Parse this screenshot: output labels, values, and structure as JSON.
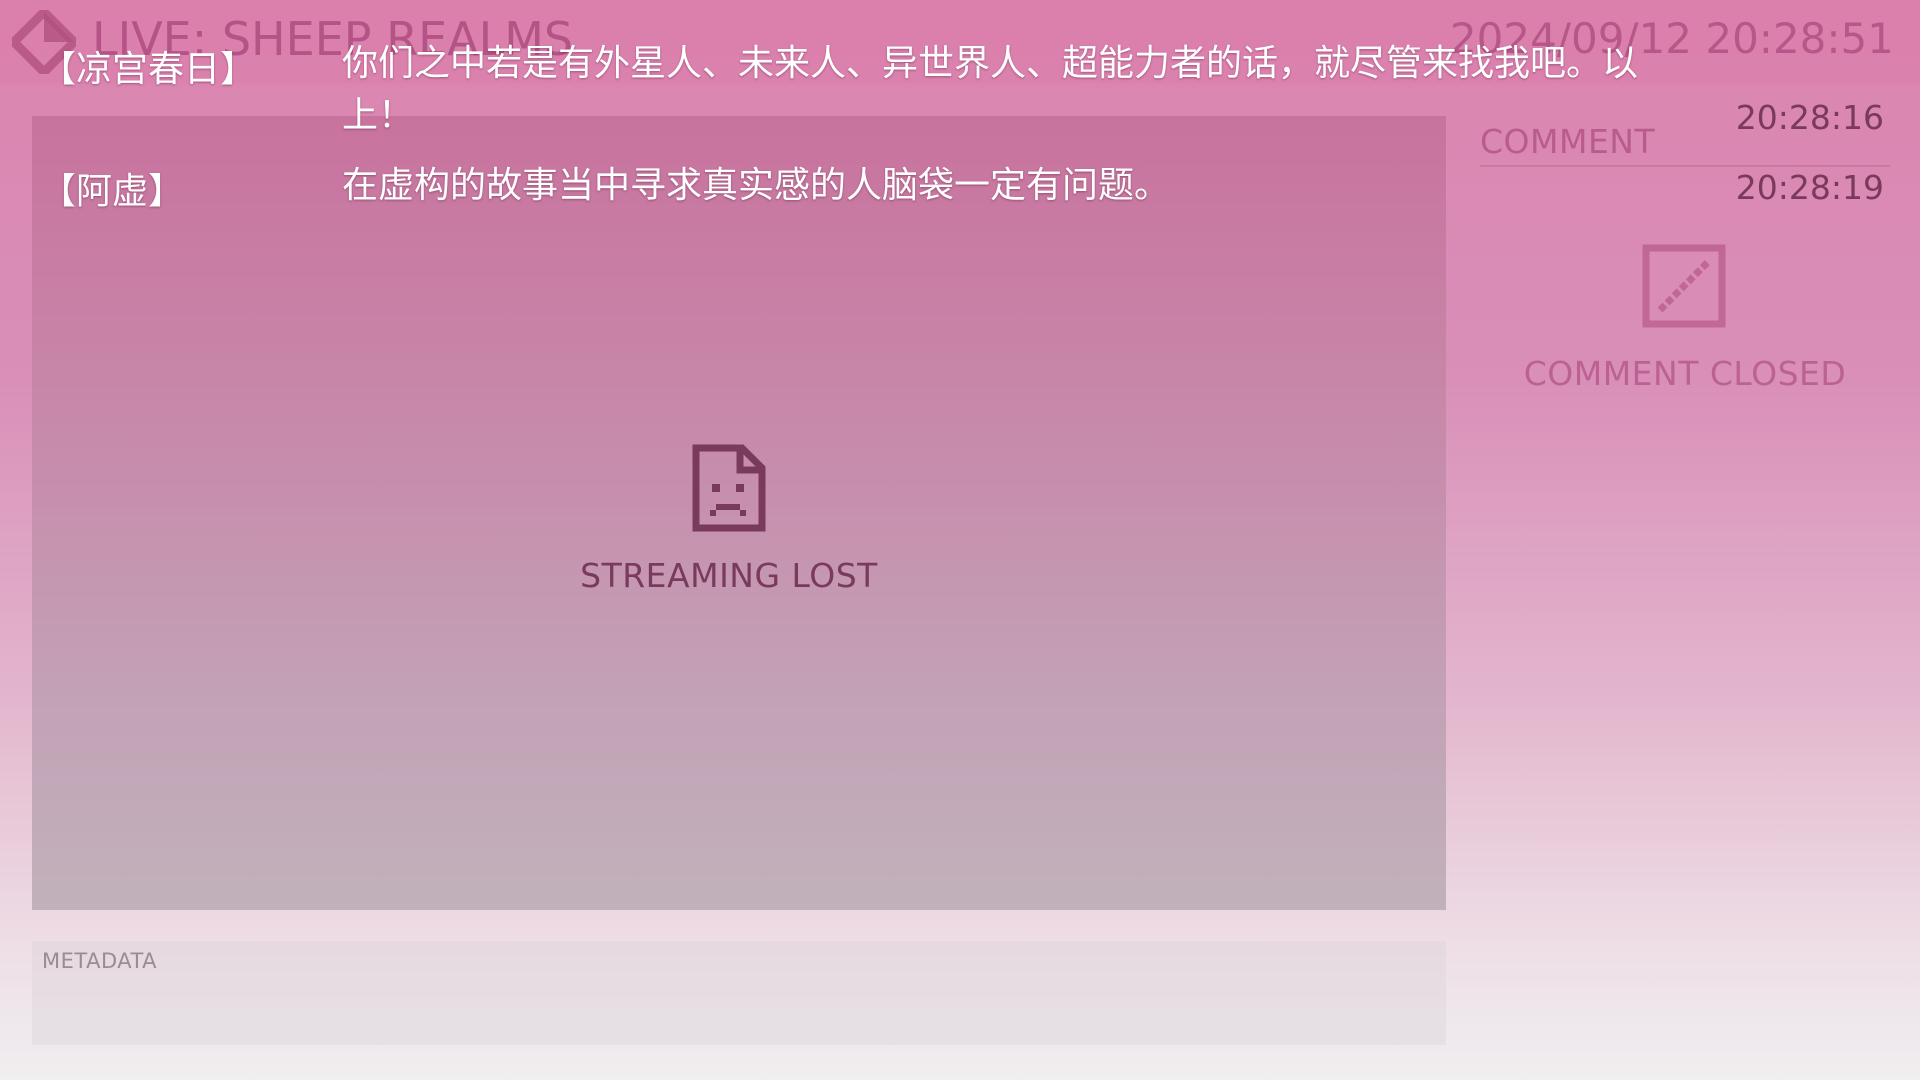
{
  "header": {
    "title": "LIVE: SHEEP REALMS",
    "datetime": "2024/09/12 20:28:51",
    "logo_icon": "diamond-logo-icon"
  },
  "stream": {
    "status_text": "STREAMING LOST",
    "status_icon": "sad-file-icon"
  },
  "metadata": {
    "label": "METADATA"
  },
  "comments": {
    "header": "COMMENT",
    "status_text": "COMMENT CLOSED",
    "status_icon": "comment-closed-icon"
  },
  "dialogue": [
    {
      "speaker": "【凉宫春日】",
      "text": "你们之中若是有外星人、未来人、异世界人、超能力者的话，就尽管来找我吧。以上！",
      "time": "20:28:16"
    },
    {
      "speaker": "【阿虚】",
      "text": "在虚构的故事当中寻求真实感的人脑袋一定有问题。",
      "time": "20:28:19"
    }
  ],
  "colors": {
    "accent": "#a8457a",
    "dialogue_text": "#ffffff",
    "dim_text": "#7a3a5c"
  }
}
